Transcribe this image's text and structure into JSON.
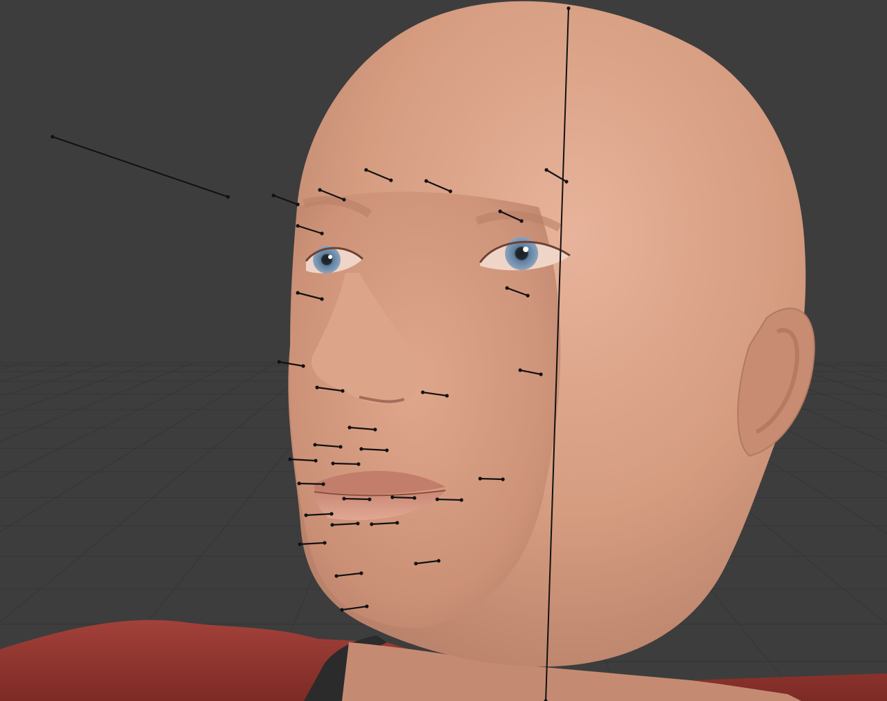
{
  "viewport": {
    "name": "3D viewport",
    "background_color": "#3d3d3d",
    "grid_color": "#4a4a4a",
    "grid_line_color": "#353535"
  },
  "model": {
    "subject": "head",
    "skin_color": "#d9a186",
    "shirt_color": "#9b3a33",
    "collar_color": "#2b2b2b",
    "eye_color": "#6f8fb0"
  },
  "bones": {
    "color": "#111111",
    "count_short": 31,
    "long_bones": 2
  }
}
